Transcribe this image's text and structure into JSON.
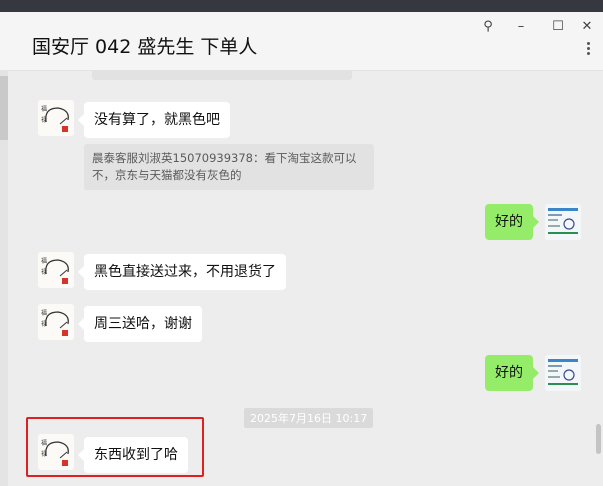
{
  "window": {
    "title": "国安厅 042 盛先生 下单人",
    "controls": {
      "pin": "⚲",
      "minimize": "–",
      "maximize": "☐",
      "close": "✕"
    }
  },
  "messages": [
    {
      "side": "in",
      "text": "没有算了，就黑色吧"
    },
    {
      "side": "quote",
      "text": "晨泰客服刘淑英15070939378：看下淘宝这款可以不，京东与天猫都没有灰色的"
    },
    {
      "side": "out",
      "text": "好的"
    },
    {
      "side": "in",
      "text": "黑色直接送过来，不用退货了"
    },
    {
      "side": "in",
      "text": "周三送哈，谢谢"
    },
    {
      "side": "out",
      "text": "好的"
    },
    {
      "side": "time",
      "text": "2025年7月16日 10:17"
    },
    {
      "side": "in",
      "text": "东西收到了哈"
    }
  ],
  "colors": {
    "outgoing_bubble": "#95ec69",
    "incoming_bubble": "#ffffff",
    "highlight_box": "#e02020",
    "background": "#ededed"
  }
}
